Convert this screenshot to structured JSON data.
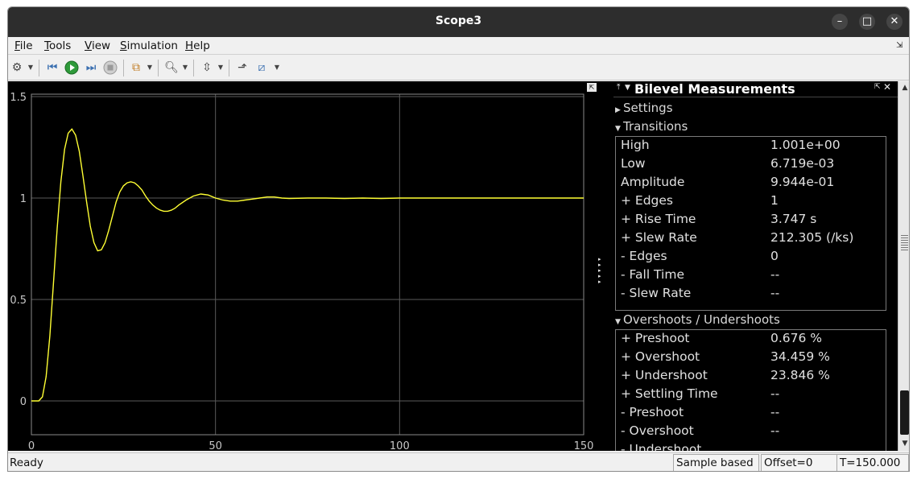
{
  "window": {
    "title": "Scope3"
  },
  "titlebar": {
    "minimize": "–",
    "maximize": "□",
    "close": "✕"
  },
  "menu": {
    "file": {
      "mn": "F",
      "rest": "ile"
    },
    "tools": {
      "mn": "T",
      "rest": "ools"
    },
    "view": {
      "mn": "V",
      "rest": "iew"
    },
    "simulation": {
      "mn": "S",
      "rest": "imulation"
    },
    "help": {
      "mn": "H",
      "rest": "elp"
    }
  },
  "toolbar": {
    "icons": [
      "gear-icon",
      "rewind-icon",
      "run-icon",
      "step-forward-icon",
      "stop-icon",
      "highlight-icon",
      "zoom-icon",
      "autoscale-icon",
      "triggers-icon",
      "measure-icon"
    ]
  },
  "plot": {
    "background": "#000000",
    "line_color": "#ffff33",
    "grid_color": "#5a5a5a"
  },
  "chart_data": {
    "type": "line",
    "title": "",
    "xlabel": "",
    "ylabel": "",
    "xlim": [
      0,
      150
    ],
    "ylim": [
      -0.15,
      1.5
    ],
    "xticks": [
      "0",
      "50",
      "100",
      "150"
    ],
    "yticks": [
      "0",
      "0.5",
      "1",
      "1.5"
    ],
    "xtick_values": [
      0,
      50,
      100,
      150
    ],
    "ytick_values": [
      0,
      0.5,
      1,
      1.5
    ],
    "grid": true,
    "series": [
      {
        "x": [
          0,
          2,
          3,
          4,
          5,
          6,
          7,
          8,
          9,
          10,
          11,
          12,
          13,
          14,
          15,
          16,
          17,
          18,
          19,
          20,
          21,
          22,
          23,
          24,
          25,
          26,
          27,
          28,
          29,
          30,
          31,
          32,
          33,
          34,
          35,
          36,
          37,
          38,
          39,
          40,
          42,
          44,
          46,
          48,
          50,
          52,
          54,
          56,
          58,
          60,
          62,
          64,
          66,
          68,
          70,
          75,
          80,
          85,
          90,
          95,
          100,
          110,
          120,
          130,
          140,
          150
        ],
        "y": [
          0,
          0,
          0.02,
          0.12,
          0.32,
          0.58,
          0.85,
          1.08,
          1.24,
          1.32,
          1.34,
          1.31,
          1.23,
          1.11,
          0.98,
          0.86,
          0.78,
          0.74,
          0.745,
          0.78,
          0.84,
          0.91,
          0.98,
          1.03,
          1.06,
          1.075,
          1.08,
          1.075,
          1.06,
          1.04,
          1.01,
          0.985,
          0.965,
          0.95,
          0.94,
          0.935,
          0.935,
          0.94,
          0.95,
          0.965,
          0.99,
          1.01,
          1.02,
          1.015,
          1.0,
          0.99,
          0.985,
          0.985,
          0.99,
          0.995,
          1.0,
          1.005,
          1.005,
          1.0,
          0.998,
          1.0,
          1.0,
          0.998,
          1.0,
          0.998,
          1.0,
          1.0,
          1.0,
          1.0,
          1.0,
          1.0
        ]
      }
    ]
  },
  "panel": {
    "title": "Bilevel Measurements",
    "settings_label": "Settings",
    "transitions_label": "Transitions",
    "transitions": [
      {
        "label": "High",
        "value": "1.001e+00"
      },
      {
        "label": "Low",
        "value": "6.719e-03"
      },
      {
        "label": "Amplitude",
        "value": "9.944e-01"
      },
      {
        "label": "+ Edges",
        "value": "1"
      },
      {
        "label": "+ Rise Time",
        "value": "3.747 s"
      },
      {
        "label": "+ Slew Rate",
        "value": "212.305 (/ks)"
      },
      {
        "label": "- Edges",
        "value": "0"
      },
      {
        "label": "- Fall Time",
        "value": "--"
      },
      {
        "label": "- Slew Rate",
        "value": "--"
      }
    ],
    "overshoots_label": "Overshoots / Undershoots",
    "overshoots": [
      {
        "label": "+ Preshoot",
        "value": "0.676 %"
      },
      {
        "label": "+ Overshoot",
        "value": "34.459 %"
      },
      {
        "label": "+ Undershoot",
        "value": "23.846 %"
      },
      {
        "label": "+ Settling Time",
        "value": "--"
      },
      {
        "label": "- Preshoot",
        "value": "--"
      },
      {
        "label": "- Overshoot",
        "value": "--"
      },
      {
        "label": "- Undershoot",
        "value": ""
      }
    ]
  },
  "status": {
    "text": "Ready",
    "mode": "Sample based",
    "offset": "Offset=0",
    "time": "T=150.000"
  }
}
